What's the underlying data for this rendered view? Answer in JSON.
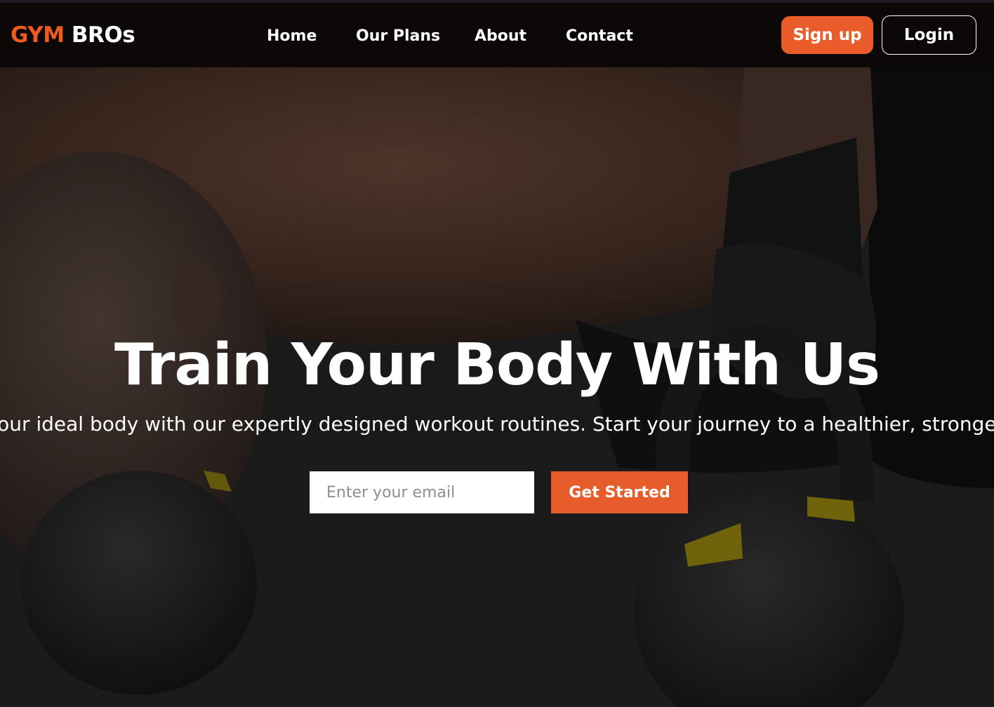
{
  "brand": {
    "accent_text": "GYM",
    "rest_text": "BROs",
    "accent_color": "#ef5a1f"
  },
  "nav": {
    "links": [
      {
        "label": "Home"
      },
      {
        "label": "Our Plans"
      },
      {
        "label": "About"
      },
      {
        "label": "Contact"
      }
    ],
    "signup_label": "Sign up",
    "login_label": "Login"
  },
  "hero": {
    "title": "Train Your Body With Us",
    "subtitle": "Achieve your ideal body with our expertly designed workout routines. Start your journey to a healthier, stronger you today.",
    "email_placeholder": "Enter your email",
    "cta_label": "Get Started",
    "background": "man doing push-ups on kettlebells (dark photo)"
  },
  "colors": {
    "navbar_bg": "#0b0807",
    "primary_orange": "#ea5c2a",
    "text_white": "#ffffff"
  }
}
